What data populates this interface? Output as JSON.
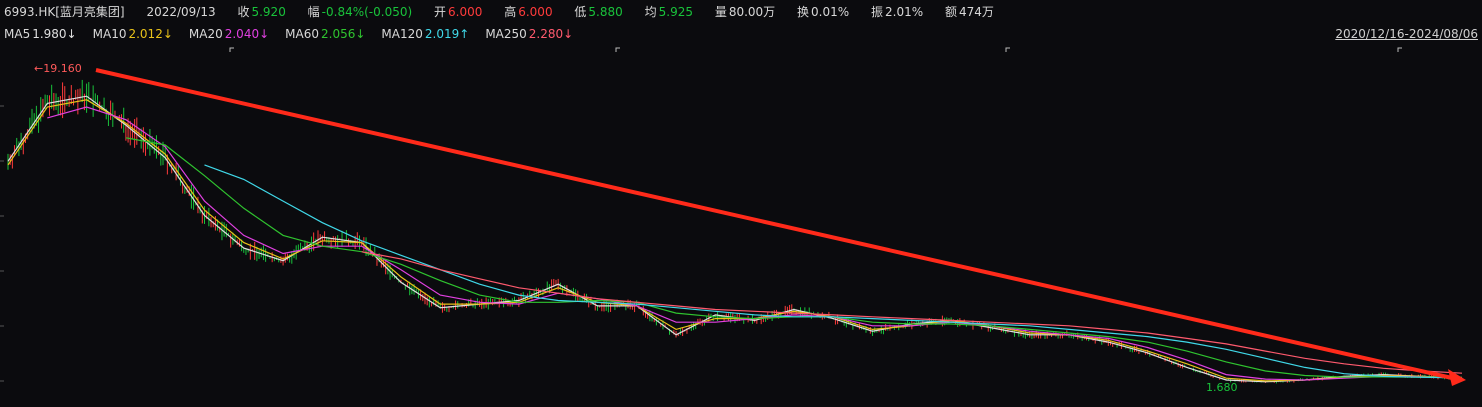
{
  "header": {
    "symbol": "6993.HK[蓝月亮集团]",
    "date": "2022/09/13",
    "close_label": "收",
    "close_value": "5.920",
    "change_label": "幅",
    "change_value": "-0.84%(-0.050)",
    "open_label": "开",
    "open_value": "6.000",
    "high_label": "高",
    "high_value": "6.000",
    "low_label": "低",
    "low_value": "5.880",
    "avg_label": "均",
    "avg_value": "5.925",
    "volume_label": "量",
    "volume_value": "80.00万",
    "turnover_label": "换",
    "turnover_value": "0.01%",
    "amplitude_label": "振",
    "amplitude_value": "2.01%",
    "amount_label": "额",
    "amount_value": "474万"
  },
  "ma_legend": [
    {
      "name": "MA5",
      "value": "1.980↓",
      "color": "#e0e0e0"
    },
    {
      "name": "MA10",
      "value": "2.012↓",
      "color": "#e8c21a"
    },
    {
      "name": "MA20",
      "value": "2.040↓",
      "color": "#e040e0"
    },
    {
      "name": "MA60",
      "value": "2.056↓",
      "color": "#2fc32f"
    },
    {
      "name": "MA120",
      "value": "2.019↑",
      "color": "#40d8e8"
    },
    {
      "name": "MA250",
      "value": "2.280↓",
      "color": "#ff5a6e"
    }
  ],
  "range_text": "2020/12/16-2024/08/06",
  "annotations": {
    "max_label": "←19.160",
    "min_label": "1.680"
  },
  "colors": {
    "background": "#0b0b0e",
    "up": "#ff3b3b",
    "down": "#19c33b",
    "trend_arrow": "#ff2a1a"
  },
  "chart_data": {
    "type": "line",
    "title": "",
    "x_range": [
      "2020/12/16",
      "2024/08/06"
    ],
    "ylim": [
      1.68,
      19.16
    ],
    "grid": false,
    "series": [
      {
        "name": "MA5",
        "values": [
          14.0,
          17.2,
          17.6,
          16.0,
          14.2,
          11.0,
          9.2,
          8.5,
          9.8,
          9.5,
          7.3,
          5.9,
          6.1,
          6.3,
          7.2,
          6.0,
          6.0,
          4.4,
          5.5,
          5.2,
          5.8,
          5.3,
          4.6,
          5.0,
          5.2,
          4.8,
          4.4,
          4.4,
          4.0,
          3.4,
          2.6,
          1.9,
          1.8,
          1.9,
          2.1,
          2.2,
          2.1,
          2.0
        ]
      },
      {
        "name": "MA10",
        "values": [
          13.8,
          17.0,
          17.4,
          16.1,
          14.4,
          11.3,
          9.5,
          8.6,
          9.6,
          9.5,
          7.6,
          6.1,
          6.1,
          6.2,
          7.0,
          6.2,
          6.0,
          4.7,
          5.3,
          5.3,
          5.7,
          5.4,
          4.7,
          4.9,
          5.2,
          4.9,
          4.5,
          4.4,
          4.1,
          3.5,
          2.8,
          2.0,
          1.85,
          1.9,
          2.05,
          2.15,
          2.1,
          2.0
        ]
      },
      {
        "name": "MA20",
        "values": [
          null,
          16.4,
          17.0,
          16.3,
          14.8,
          11.8,
          9.9,
          8.9,
          9.3,
          9.3,
          8.0,
          6.6,
          6.2,
          6.1,
          6.7,
          6.4,
          6.0,
          5.1,
          5.1,
          5.3,
          5.5,
          5.4,
          4.9,
          4.9,
          5.1,
          4.9,
          4.6,
          4.4,
          4.2,
          3.7,
          3.0,
          2.2,
          1.95,
          1.9,
          2.0,
          2.1,
          2.08,
          2.04
        ]
      },
      {
        "name": "MA60",
        "values": [
          null,
          null,
          null,
          15.3,
          14.9,
          13.2,
          11.4,
          9.9,
          9.3,
          9.0,
          8.3,
          7.4,
          6.6,
          6.2,
          6.2,
          6.3,
          6.2,
          5.6,
          5.4,
          5.3,
          5.4,
          5.4,
          5.1,
          5.0,
          5.0,
          4.9,
          4.7,
          4.5,
          4.3,
          4.0,
          3.5,
          2.9,
          2.4,
          2.15,
          2.06,
          2.07,
          2.06,
          2.056
        ]
      },
      {
        "name": "MA120",
        "values": [
          null,
          null,
          null,
          null,
          null,
          13.8,
          13.0,
          11.8,
          10.6,
          9.6,
          8.8,
          8.0,
          7.2,
          6.6,
          6.3,
          6.2,
          6.1,
          5.9,
          5.7,
          5.5,
          5.4,
          5.4,
          5.3,
          5.2,
          5.1,
          5.0,
          4.9,
          4.7,
          4.5,
          4.3,
          4.0,
          3.6,
          3.1,
          2.6,
          2.25,
          2.1,
          2.05,
          2.019
        ]
      },
      {
        "name": "MA250",
        "values": [
          null,
          null,
          null,
          null,
          null,
          null,
          null,
          null,
          null,
          9.0,
          8.6,
          8.0,
          7.5,
          7.0,
          6.7,
          6.4,
          6.2,
          6.0,
          5.8,
          5.7,
          5.6,
          5.5,
          5.4,
          5.3,
          5.2,
          5.1,
          5.0,
          4.9,
          4.7,
          4.5,
          4.2,
          3.9,
          3.5,
          3.1,
          2.8,
          2.55,
          2.4,
          2.28
        ]
      }
    ]
  }
}
